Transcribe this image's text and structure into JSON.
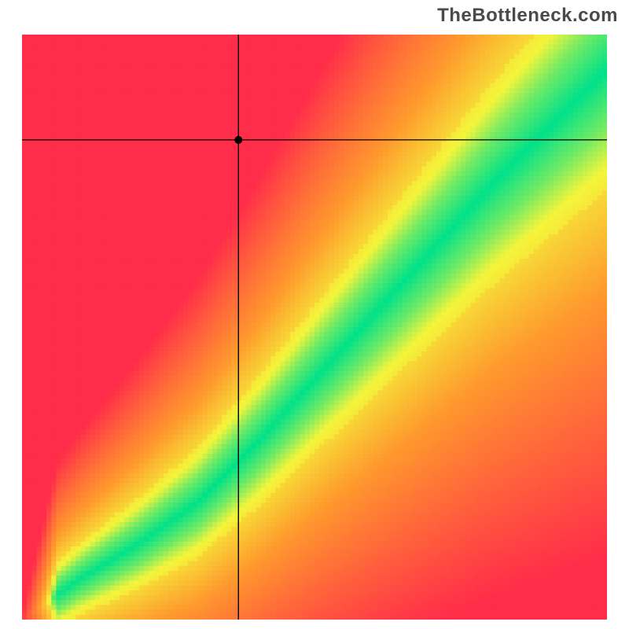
{
  "attribution": "TheBottleneck.com",
  "chart_data": {
    "type": "heatmap",
    "title": "",
    "xlabel": "",
    "ylabel": "",
    "xlim": [
      0,
      100
    ],
    "ylim": [
      0,
      100
    ],
    "crosshair": {
      "x": 37,
      "y": 82
    },
    "marker": {
      "x": 37,
      "y": 82,
      "radius": 5
    },
    "optimal_band": {
      "description": "diagonal green band indicating balanced pairing",
      "points_center": [
        {
          "x": 0,
          "y": 0
        },
        {
          "x": 10,
          "y": 7
        },
        {
          "x": 20,
          "y": 13
        },
        {
          "x": 30,
          "y": 20
        },
        {
          "x": 40,
          "y": 30
        },
        {
          "x": 50,
          "y": 41
        },
        {
          "x": 60,
          "y": 52
        },
        {
          "x": 70,
          "y": 63
        },
        {
          "x": 80,
          "y": 74
        },
        {
          "x": 90,
          "y": 84
        },
        {
          "x": 100,
          "y": 94
        }
      ],
      "half_width": 6
    },
    "color_stops": {
      "best": "#00e28a",
      "good": "#f5f53b",
      "mid": "#ff9a2e",
      "bad": "#ff2d4a"
    },
    "resolution": 120
  }
}
